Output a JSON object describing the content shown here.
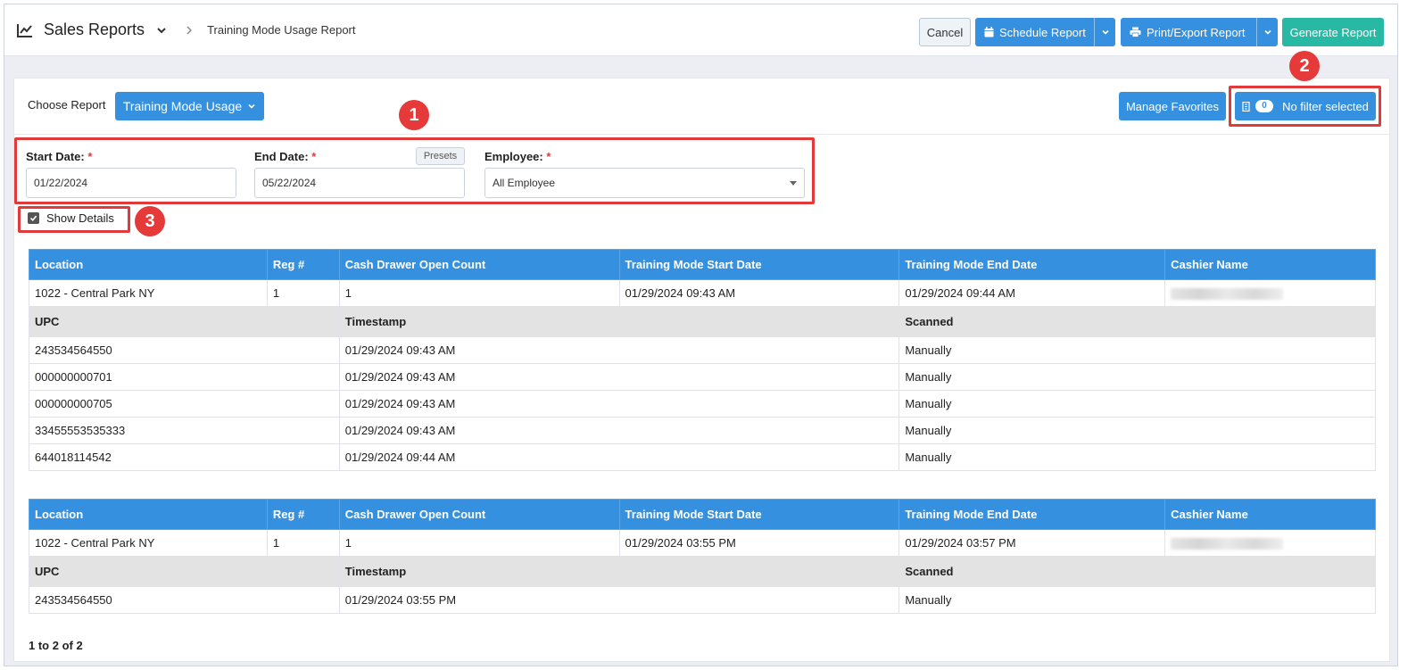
{
  "header": {
    "app_title": "Sales Reports",
    "breadcrumb": "Training Mode Usage Report",
    "cancel_label": "Cancel",
    "schedule_label": "Schedule Report",
    "print_label": "Print/Export Report",
    "generate_label": "Generate Report"
  },
  "panel": {
    "choose_label": "Choose Report",
    "report_selected": "Training Mode Usage",
    "manage_favorites_label": "Manage Favorites",
    "filter_count": "0",
    "filter_label": "No filter selected"
  },
  "filters": {
    "start_label": "Start Date:",
    "start_value": "01/22/2024",
    "end_label": "End Date:",
    "end_value": "05/22/2024",
    "presets_label": "Presets",
    "employee_label": "Employee:",
    "employee_value": "All Employee",
    "required_mark": "*",
    "show_details_label": "Show Details",
    "show_details_checked": true
  },
  "annotations": [
    "1",
    "2",
    "3"
  ],
  "table_headers": [
    "Location",
    "Reg #",
    "Cash Drawer Open Count",
    "Training Mode Start Date",
    "Training Mode End Date",
    "Cashier Name"
  ],
  "detail_headers": [
    "UPC",
    "Timestamp",
    "Scanned"
  ],
  "sessions": [
    {
      "location": "1022 - Central Park NY",
      "reg": "1",
      "drawer_count": "1",
      "start": "01/29/2024 09:43 AM",
      "end": "01/29/2024 09:44 AM",
      "details": [
        {
          "upc": "243534564550",
          "timestamp": "01/29/2024 09:43 AM",
          "scanned": "Manually"
        },
        {
          "upc": "000000000701",
          "timestamp": "01/29/2024 09:43 AM",
          "scanned": "Manually"
        },
        {
          "upc": "000000000705",
          "timestamp": "01/29/2024 09:43 AM",
          "scanned": "Manually"
        },
        {
          "upc": "33455553535333",
          "timestamp": "01/29/2024 09:43 AM",
          "scanned": "Manually"
        },
        {
          "upc": "644018114542",
          "timestamp": "01/29/2024 09:44 AM",
          "scanned": "Manually"
        }
      ]
    },
    {
      "location": "1022 - Central Park NY",
      "reg": "1",
      "drawer_count": "1",
      "start": "01/29/2024 03:55 PM",
      "end": "01/29/2024 03:57 PM",
      "details": [
        {
          "upc": "243534564550",
          "timestamp": "01/29/2024 03:55 PM",
          "scanned": "Manually"
        }
      ]
    }
  ],
  "paging_text": "1 to 2 of 2",
  "colors": {
    "primary": "#3591e0",
    "teal": "#28b9a5",
    "annotation": "#e03a3a"
  }
}
